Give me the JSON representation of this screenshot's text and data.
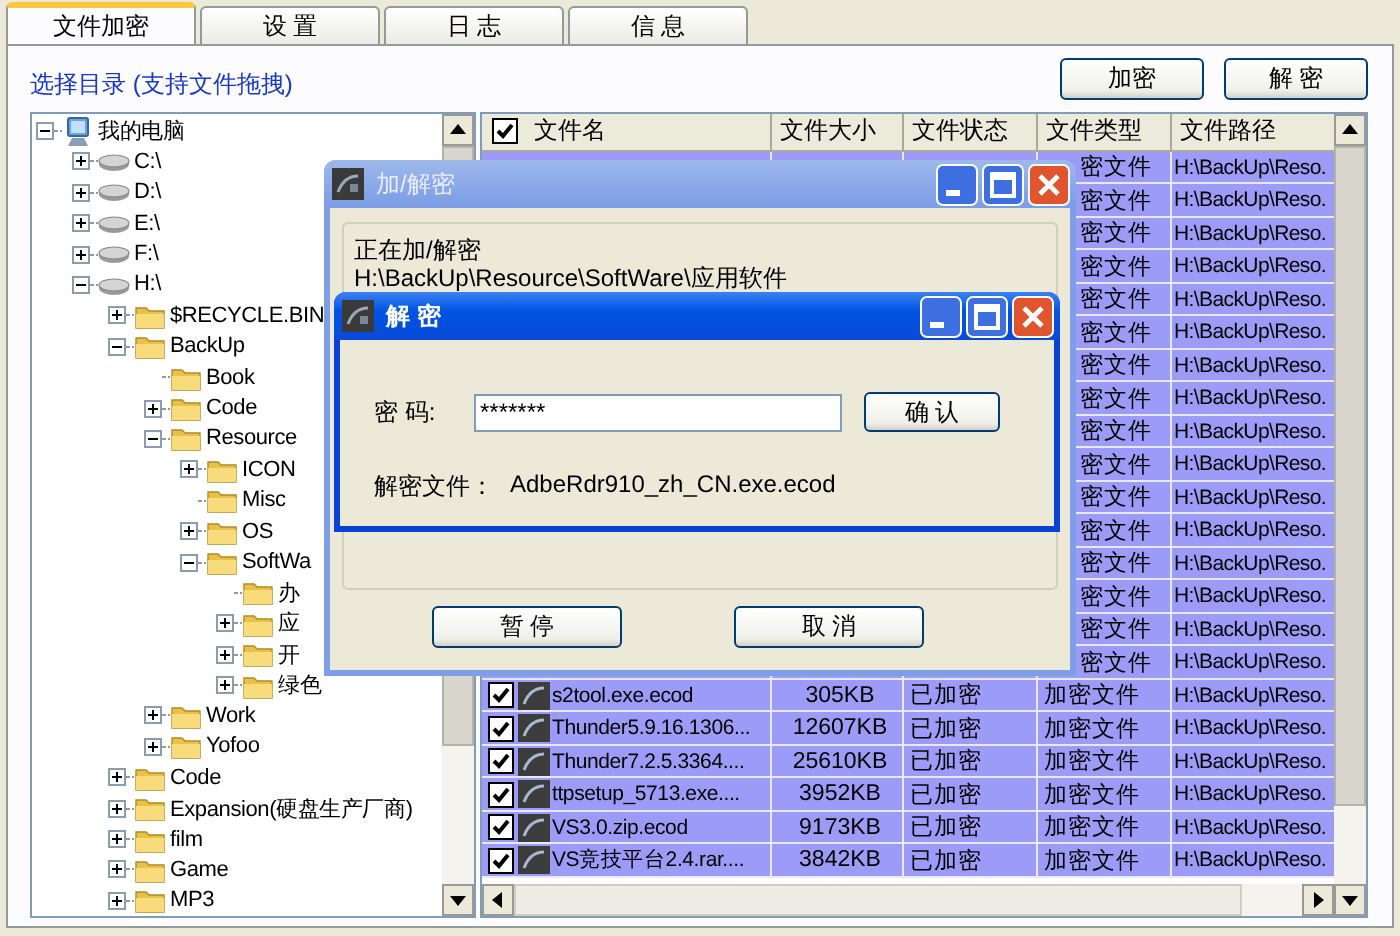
{
  "tabs": [
    {
      "label": "文件加密",
      "selected": true
    },
    {
      "label": "设 置",
      "selected": false
    },
    {
      "label": "日 志",
      "selected": false
    },
    {
      "label": "信 息",
      "selected": false
    }
  ],
  "directory_label": "选择目录 (支持文件拖拽)",
  "buttons": [
    "加密",
    "解 密"
  ],
  "tree": {
    "items": [
      {
        "label": "我的电脑",
        "kind": "computer",
        "expanded": true,
        "children": [
          {
            "label": "C:\\",
            "kind": "drive",
            "expanded": false
          },
          {
            "label": "D:\\",
            "kind": "drive",
            "expanded": false
          },
          {
            "label": "E:\\",
            "kind": "drive",
            "expanded": false
          },
          {
            "label": "F:\\",
            "kind": "drive",
            "expanded": false
          },
          {
            "label": "H:\\",
            "kind": "drive",
            "expanded": true,
            "children": [
              {
                "label": "$RECYCLE.BIN",
                "kind": "folder",
                "expanded": false
              },
              {
                "label": "BackUp",
                "kind": "folder",
                "expanded": true,
                "children": [
                  {
                    "label": "Book",
                    "kind": "folder"
                  },
                  {
                    "label": "Code",
                    "kind": "folder",
                    "expanded": false
                  },
                  {
                    "label": "Resource",
                    "kind": "folder",
                    "expanded": true,
                    "children": [
                      {
                        "label": "ICON",
                        "kind": "folder",
                        "expanded": false
                      },
                      {
                        "label": "Misc",
                        "kind": "folder"
                      },
                      {
                        "label": "OS",
                        "kind": "folder",
                        "expanded": false
                      },
                      {
                        "label": "SoftWa",
                        "kind": "folder",
                        "expanded": true,
                        "children": [
                          {
                            "label": "办",
                            "kind": "folder"
                          },
                          {
                            "label": "应",
                            "kind": "folder",
                            "expanded": false
                          },
                          {
                            "label": "开",
                            "kind": "folder",
                            "expanded": false
                          },
                          {
                            "label": "绿色",
                            "kind": "folder",
                            "expanded": false
                          }
                        ]
                      }
                    ]
                  },
                  {
                    "label": "Work",
                    "kind": "folder",
                    "expanded": false
                  },
                  {
                    "label": "Yofoo",
                    "kind": "folder",
                    "expanded": false
                  }
                ]
              },
              {
                "label": "Code",
                "kind": "folder",
                "expanded": false
              },
              {
                "label": "Expansion(硬盘生产厂商)",
                "kind": "folder",
                "expanded": false
              },
              {
                "label": "film",
                "kind": "folder",
                "expanded": false
              },
              {
                "label": "Game",
                "kind": "folder",
                "expanded": false
              },
              {
                "label": "MP3",
                "kind": "folder",
                "expanded": false
              }
            ]
          }
        ]
      }
    ]
  },
  "table": {
    "header_checked": true,
    "columns": [
      "文件名",
      "文件大小",
      "文件状态",
      "文件类型",
      "文件路径"
    ],
    "rows": [
      {
        "selected": true,
        "type": "密文件",
        "path": "H:\\BackUp\\Reso."
      },
      {
        "selected": true,
        "type": "密文件",
        "path": "H:\\BackUp\\Reso."
      },
      {
        "selected": true,
        "type": "密文件",
        "path": "H:\\BackUp\\Reso."
      },
      {
        "selected": true,
        "type": "密文件",
        "path": "H:\\BackUp\\Reso."
      },
      {
        "selected": true,
        "type": "密文件",
        "path": "H:\\BackUp\\Reso."
      },
      {
        "selected": true,
        "type": "密文件",
        "path": "H:\\BackUp\\Reso."
      },
      {
        "selected": true,
        "type": "密文件",
        "path": "H:\\BackUp\\Reso."
      },
      {
        "selected": true,
        "type": "密文件",
        "path": "H:\\BackUp\\Reso."
      },
      {
        "selected": true,
        "type": "密文件",
        "path": "H:\\BackUp\\Reso."
      },
      {
        "selected": true,
        "type": "密文件",
        "path": "H:\\BackUp\\Reso."
      },
      {
        "selected": true,
        "type": "密文件",
        "path": "H:\\BackUp\\Reso."
      },
      {
        "selected": true,
        "type": "密文件",
        "path": "H:\\BackUp\\Reso."
      },
      {
        "selected": true,
        "type": "密文件",
        "path": "H:\\BackUp\\Reso."
      },
      {
        "selected": true,
        "type": "密文件",
        "path": "H:\\BackUp\\Reso."
      },
      {
        "selected": true,
        "type": "密文件",
        "path": "H:\\BackUp\\Reso."
      },
      {
        "selected": true,
        "type": "密文件",
        "path": "H:\\BackUp\\Reso."
      },
      {
        "selected": true,
        "checked": true,
        "name": "s2tool.exe.ecod",
        "size": "305KB",
        "status": "已加密",
        "type": "加密文件",
        "path": "H:\\BackUp\\Reso."
      },
      {
        "selected": true,
        "checked": true,
        "name": "Thunder5.9.16.1306...",
        "size": "12607KB",
        "status": "已加密",
        "type": "加密文件",
        "path": "H:\\BackUp\\Reso."
      },
      {
        "selected": true,
        "checked": true,
        "name": "Thunder7.2.5.3364....",
        "size": "25610KB",
        "status": "已加密",
        "type": "加密文件",
        "path": "H:\\BackUp\\Reso."
      },
      {
        "selected": true,
        "checked": true,
        "name": "ttpsetup_5713.exe....",
        "size": "3952KB",
        "status": "已加密",
        "type": "加密文件",
        "path": "H:\\BackUp\\Reso."
      },
      {
        "selected": true,
        "checked": true,
        "name": "VS3.0.zip.ecod",
        "size": "9173KB",
        "status": "已加密",
        "type": "加密文件",
        "path": "H:\\BackUp\\Reso."
      },
      {
        "selected": true,
        "checked": true,
        "name": "VS竞技平台2.4.rar....",
        "size": "3842KB",
        "status": "已加密",
        "type": "加密文件",
        "path": "H:\\BackUp\\Reso."
      }
    ]
  },
  "progress_dialog": {
    "title": "加/解密",
    "status": "正在加/解密",
    "path": "H:\\BackUp\\Resource\\SoftWare\\应用软件",
    "buttons": [
      "暂 停",
      "取 消"
    ]
  },
  "password_dialog": {
    "title": "解 密",
    "password_label": "密 码:",
    "password": "*******",
    "confirm": "确 认",
    "file_label": "解密文件：",
    "file": "AdbeRdr910_zh_CN.exe.ecod"
  }
}
